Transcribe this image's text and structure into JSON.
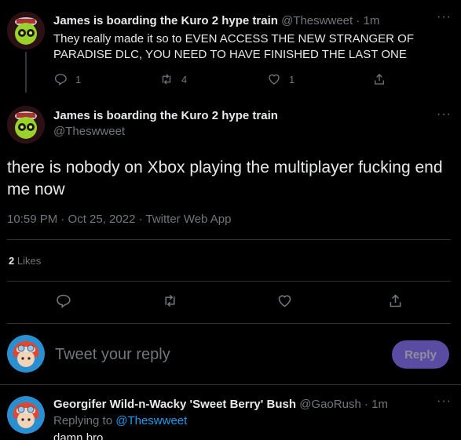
{
  "tweet1": {
    "author_name": "James is boarding the Kuro 2 hype train",
    "handle": "@Theswweet",
    "time": "· 1m",
    "text": "They really made it so to EVEN ACCESS THE NEW STRANGER OF PARADISE DLC, YOU NEED TO HAVE FINISHED THE LAST ONE",
    "reply_count": "1",
    "retweet_count": "4",
    "like_count": "1"
  },
  "main_tweet": {
    "author_name": "James is boarding the Kuro 2 hype train",
    "handle": "@Theswweet",
    "text": "there is nobody on Xbox playing the multiplayer fucking end me now",
    "timestamp": "10:59 PM · Oct 25, 2022 · Twitter Web App",
    "likes_count": "2",
    "likes_label": "Likes"
  },
  "composer": {
    "placeholder": "Tweet your reply",
    "reply_button": "Reply"
  },
  "reply_tweet": {
    "author_name": "Georgifer Wild-n-Wacky 'Sweet Berry' Bush",
    "handle": "@GaoRush",
    "time": "· 1m",
    "replying_prefix": "Replying to",
    "replying_handle": "@Theswweet",
    "text": "damn bro"
  },
  "icons": {
    "reply": "reply-icon",
    "retweet": "retweet-icon",
    "like": "heart-icon",
    "share": "share-icon",
    "more": "more-icon"
  },
  "colors": {
    "background": "#000000",
    "accent": "#1d9bf0",
    "reply_button_bg": "#5b4ca3",
    "muted": "#71767b"
  }
}
